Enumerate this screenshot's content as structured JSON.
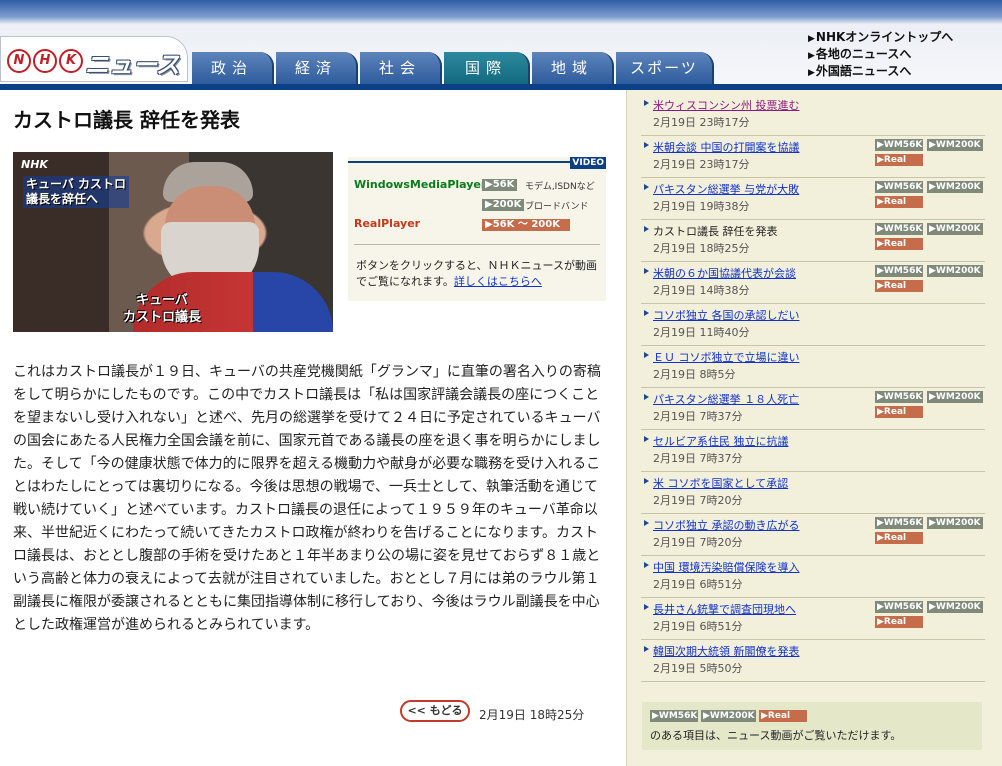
{
  "header": {
    "logo_circles": [
      "N",
      "H",
      "K"
    ],
    "logo_word": "ニュース",
    "tabs": [
      "政治",
      "経済",
      "社会",
      "国際",
      "地域",
      "スポーツ"
    ],
    "active_tab": "国際",
    "links": [
      "NHKオンライントップへ",
      "各地のニュースへ",
      "外国語ニュースへ"
    ],
    "accent_color": "#0b3f86"
  },
  "article": {
    "headline": "カストロ議長 辞任を発表",
    "photo": {
      "watermark": "NHK",
      "caption_top": [
        "キューバ カストロ",
        "議長を辞任へ"
      ],
      "caption_bottom": [
        "キューバ",
        "カストロ議長"
      ]
    },
    "body": "これはカストロ議長が１９日、キューバの共産党機関紙「グランマ」に直筆の署名入りの寄稿をして明らかにしたものです。この中でカストロ議長は「私は国家評議会議長の座につくことを望まないし受け入れない」と述べ、先月の総選挙を受けて２４日に予定されているキューバの国会にあたる人民権力全国会議を前に、国家元首である議長の座を退く事を明らかにしました。そして「今の健康状態で体力的に限界を超える機動力や献身が必要な職務を受け入れることはわたしにとっては裏切りになる。今後は思想の戦場で、一兵士として、執筆活動を通じて戦い続けていく」と述べています。カストロ議長の退任によって１９５９年のキューバ革命以来、半世紀近くにわたって続いてきたカストロ政権が終わりを告げることになります。カストロ議長は、おととし腹部の手術を受けたあと１年半あまり公の場に姿を見せておらず８１歳という高齢と体力の衰えによって去就が注目されていました。おととし７月には弟のラウル第１副議長に権限が委譲されるとともに集団指導体制に移行しており、今後はラウル副議長を中心とした政権運営が進められるとみられています。",
    "back_label": "<< もどる",
    "published": "2月19日 18時25分"
  },
  "video": {
    "label": "VIDEO",
    "wmp_label": "WindowsMediaPlayer",
    "wmp_btn_56": "▶56K",
    "wmp_note_56": "モデム,ISDNなど",
    "wmp_btn_200": "▶200K",
    "wmp_note_200": "ブロードバンド",
    "real_label": "RealPlayer",
    "real_btn": "▶56K 〜 200K",
    "note": "ボタンをクリックすると、ＮＨＫニュースが動画でご覧になれます。",
    "note_link": "詳しくはこちらへ",
    "colors": {
      "wmp": "#0a7a1a",
      "real": "#c23a1a"
    }
  },
  "sidebar": {
    "btn_wm56": "▶WM56K",
    "btn_wm200": "▶WM200K",
    "btn_real": "▶Real",
    "items": [
      {
        "title": "米ウィスコンシン州 投票進む",
        "time": "2月19日 23時17分",
        "video": false,
        "state": "visited"
      },
      {
        "title": "米朝会談 中国の打開案を協議",
        "time": "2月19日 23時17分",
        "video": true,
        "state": "link"
      },
      {
        "title": "パキスタン総選挙 与党が大敗",
        "time": "2月19日 19時38分",
        "video": true,
        "state": "link"
      },
      {
        "title": "カストロ議長 辞任を発表",
        "time": "2月19日 18時25分",
        "video": true,
        "state": "current"
      },
      {
        "title": "米朝の６か国協議代表が会談",
        "time": "2月19日 14時38分",
        "video": true,
        "state": "link"
      },
      {
        "title": "コソボ独立 各国の承認しだい",
        "time": "2月19日 11時40分",
        "video": false,
        "state": "link"
      },
      {
        "title": "ＥＵ コソボ独立で立場に違い",
        "time": "2月19日 8時5分",
        "video": false,
        "state": "link"
      },
      {
        "title": "パキスタン総選挙 １８人死亡",
        "time": "2月19日 7時37分",
        "video": true,
        "state": "link"
      },
      {
        "title": "セルビア系住民 独立に抗議",
        "time": "2月19日 7時37分",
        "video": false,
        "state": "link"
      },
      {
        "title": "米 コソボを国家として承認",
        "time": "2月19日 7時20分",
        "video": false,
        "state": "link"
      },
      {
        "title": "コソボ独立 承認の動き広がる",
        "time": "2月19日 7時20分",
        "video": true,
        "state": "link"
      },
      {
        "title": "中国 環境汚染賠償保険を導入",
        "time": "2月19日 6時51分",
        "video": false,
        "state": "link"
      },
      {
        "title": "長井さん銃撃で調査団現地へ",
        "time": "2月19日 6時51分",
        "video": true,
        "state": "link"
      },
      {
        "title": "韓国次期大統領 新閣僚を発表",
        "time": "2月19日 5時50分",
        "video": false,
        "state": "link"
      }
    ],
    "legend_text": "のある項目は、ニュース動画がご覧いただけます。"
  }
}
